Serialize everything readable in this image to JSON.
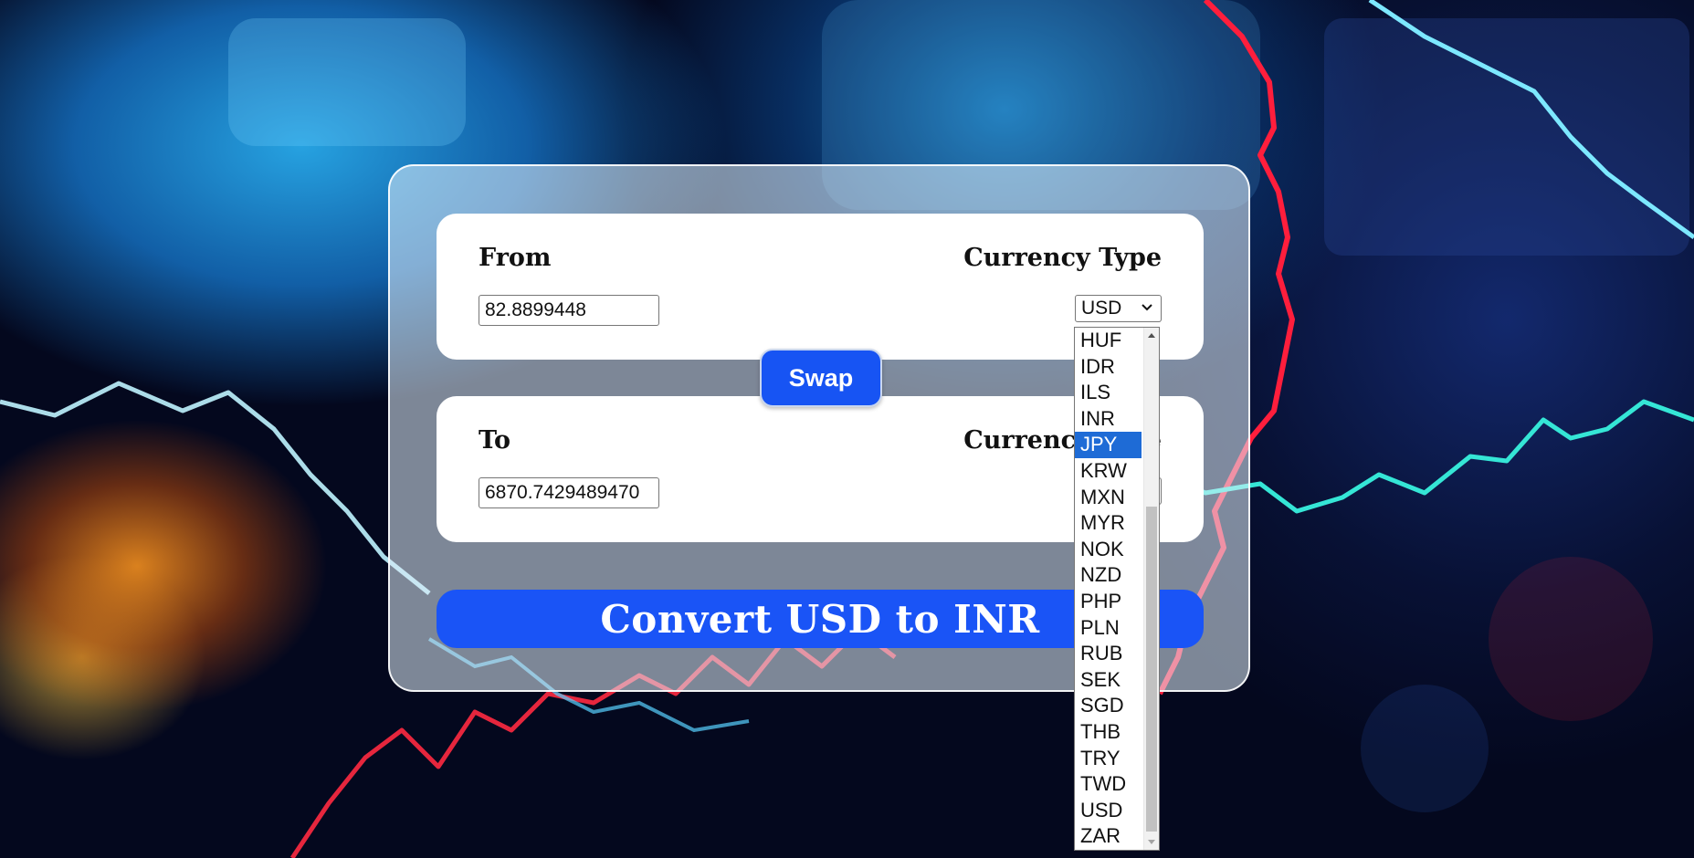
{
  "from_panel": {
    "label": "From",
    "type_label": "Currency Type",
    "amount_value": "82.8899448",
    "currency_selected": "USD"
  },
  "to_panel": {
    "label": "To",
    "type_label": "Currency Type",
    "amount_value": "6870.7429489470"
  },
  "swap_button": {
    "label": "Swap"
  },
  "convert_button": {
    "label": "Convert USD to INR"
  },
  "dropdown": {
    "options": [
      "HUF",
      "IDR",
      "ILS",
      "INR",
      "JPY",
      "KRW",
      "MXN",
      "MYR",
      "NOK",
      "NZD",
      "PHP",
      "PLN",
      "RUB",
      "SEK",
      "SGD",
      "THB",
      "TRY",
      "TWD",
      "USD",
      "ZAR"
    ],
    "highlighted": "JPY"
  },
  "colors": {
    "primary_button": "#1a54f6",
    "highlight": "#1e6bd6",
    "panel": "#ffffff"
  },
  "icons": {
    "select_arrow": "chevron-down-icon"
  }
}
